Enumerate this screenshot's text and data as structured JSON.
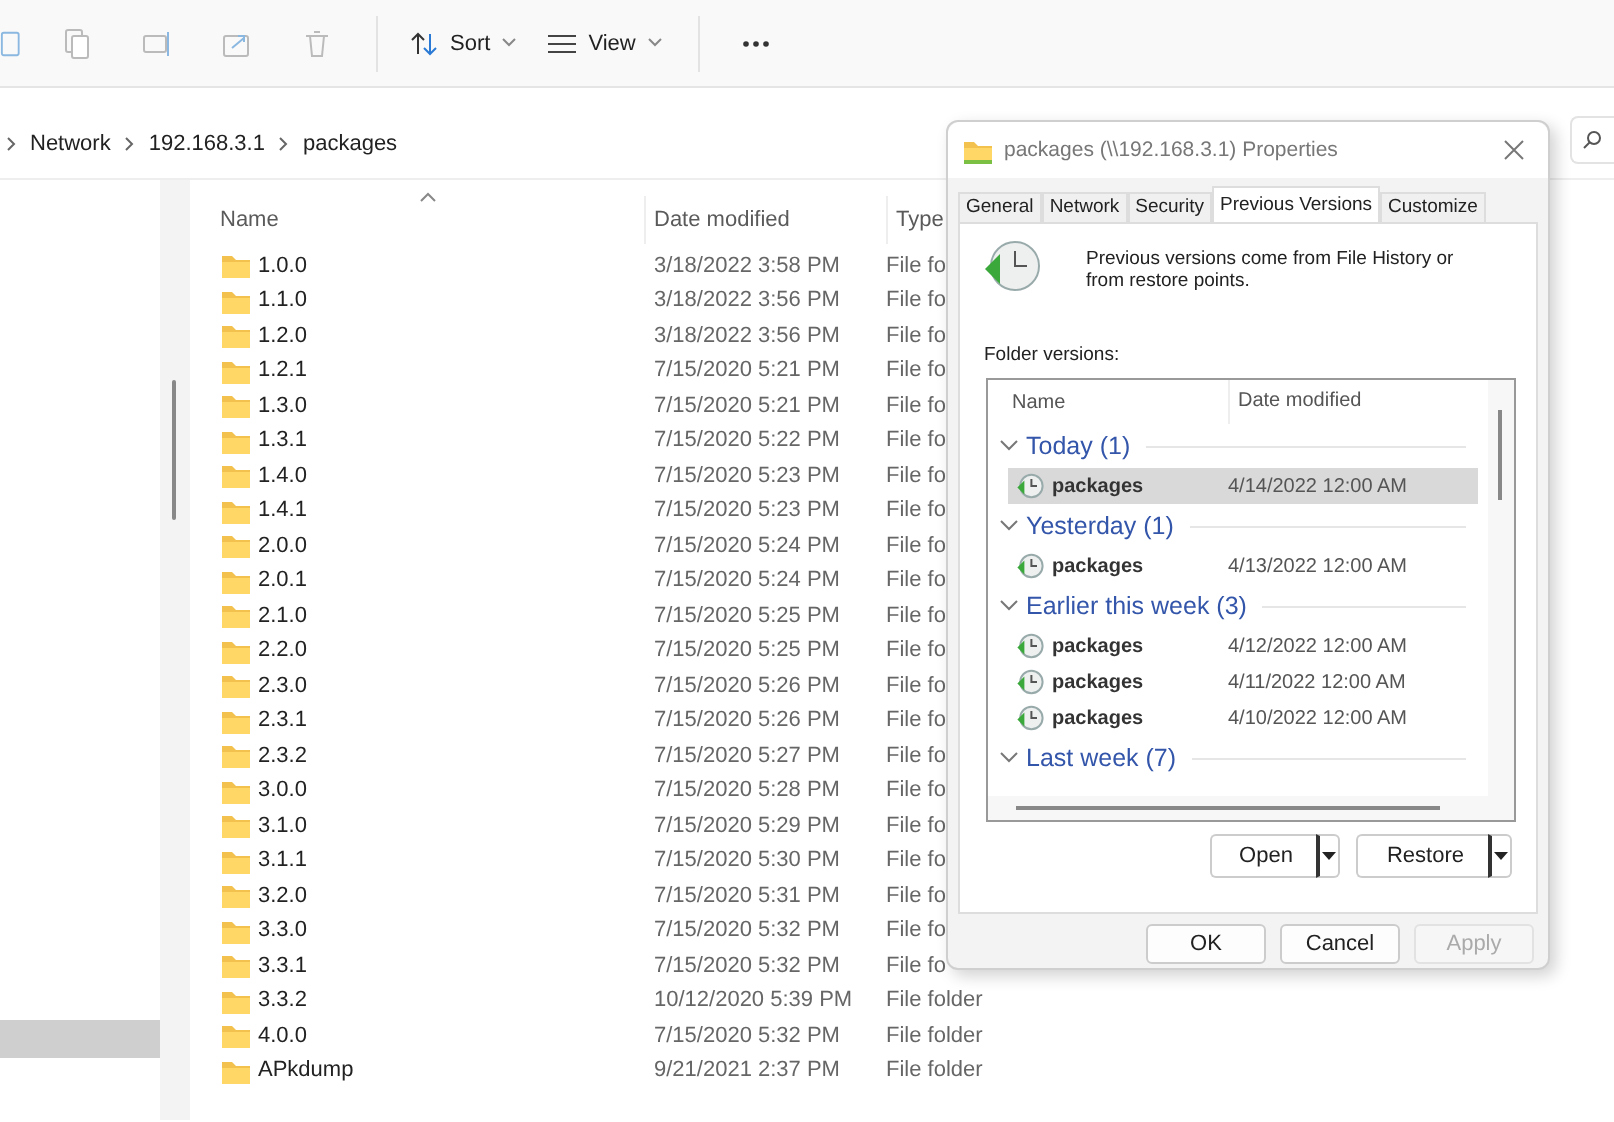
{
  "toolbar": {
    "sort_label": "Sort",
    "view_label": "View"
  },
  "breadcrumb": [
    "Network",
    "192.168.3.1",
    "packages"
  ],
  "file_list": {
    "columns": [
      "Name",
      "Date modified",
      "Type"
    ],
    "rows": [
      {
        "name": "1.0.0",
        "date": "3/18/2022 3:58 PM",
        "type": "File fo"
      },
      {
        "name": "1.1.0",
        "date": "3/18/2022 3:56 PM",
        "type": "File fo"
      },
      {
        "name": "1.2.0",
        "date": "3/18/2022 3:56 PM",
        "type": "File fo"
      },
      {
        "name": "1.2.1",
        "date": "7/15/2020 5:21 PM",
        "type": "File fo"
      },
      {
        "name": "1.3.0",
        "date": "7/15/2020 5:21 PM",
        "type": "File fo"
      },
      {
        "name": "1.3.1",
        "date": "7/15/2020 5:22 PM",
        "type": "File fo"
      },
      {
        "name": "1.4.0",
        "date": "7/15/2020 5:23 PM",
        "type": "File fo"
      },
      {
        "name": "1.4.1",
        "date": "7/15/2020 5:23 PM",
        "type": "File fo"
      },
      {
        "name": "2.0.0",
        "date": "7/15/2020 5:24 PM",
        "type": "File fo"
      },
      {
        "name": "2.0.1",
        "date": "7/15/2020 5:24 PM",
        "type": "File fo"
      },
      {
        "name": "2.1.0",
        "date": "7/15/2020 5:25 PM",
        "type": "File fo"
      },
      {
        "name": "2.2.0",
        "date": "7/15/2020 5:25 PM",
        "type": "File fo"
      },
      {
        "name": "2.3.0",
        "date": "7/15/2020 5:26 PM",
        "type": "File fo"
      },
      {
        "name": "2.3.1",
        "date": "7/15/2020 5:26 PM",
        "type": "File fo"
      },
      {
        "name": "2.3.2",
        "date": "7/15/2020 5:27 PM",
        "type": "File fo"
      },
      {
        "name": "3.0.0",
        "date": "7/15/2020 5:28 PM",
        "type": "File fo"
      },
      {
        "name": "3.1.0",
        "date": "7/15/2020 5:29 PM",
        "type": "File fo"
      },
      {
        "name": "3.1.1",
        "date": "7/15/2020 5:30 PM",
        "type": "File fo"
      },
      {
        "name": "3.2.0",
        "date": "7/15/2020 5:31 PM",
        "type": "File fo"
      },
      {
        "name": "3.3.0",
        "date": "7/15/2020 5:32 PM",
        "type": "File fo"
      },
      {
        "name": "3.3.1",
        "date": "7/15/2020 5:32 PM",
        "type": "File fo"
      },
      {
        "name": "3.3.2",
        "date": "10/12/2020 5:39 PM",
        "type": "File folder"
      },
      {
        "name": "4.0.0",
        "date": "7/15/2020 5:32 PM",
        "type": "File folder"
      },
      {
        "name": "APkdump",
        "date": "9/21/2021 2:37 PM",
        "type": "File folder"
      }
    ]
  },
  "dialog": {
    "title": "packages (\\\\192.168.3.1) Properties",
    "tabs": [
      {
        "label": "General",
        "selected": false
      },
      {
        "label": "Network",
        "selected": false
      },
      {
        "label": "Security",
        "selected": false
      },
      {
        "label": "Previous Versions",
        "selected": true
      },
      {
        "label": "Customize",
        "selected": false
      }
    ],
    "description": "Previous versions come from File History or from restore points.",
    "versions_label": "Folder versions:",
    "versions_columns": [
      "Name",
      "Date modified"
    ],
    "groups": [
      {
        "label": "Today (1)",
        "expanded": true,
        "items": [
          {
            "name": "packages",
            "date": "4/14/2022 12:00 AM",
            "selected": true
          }
        ]
      },
      {
        "label": "Yesterday (1)",
        "expanded": true,
        "items": [
          {
            "name": "packages",
            "date": "4/13/2022 12:00 AM",
            "selected": false
          }
        ]
      },
      {
        "label": "Earlier this week (3)",
        "expanded": true,
        "items": [
          {
            "name": "packages",
            "date": "4/12/2022 12:00 AM",
            "selected": false
          },
          {
            "name": "packages",
            "date": "4/11/2022 12:00 AM",
            "selected": false
          },
          {
            "name": "packages",
            "date": "4/10/2022 12:00 AM",
            "selected": false
          }
        ]
      },
      {
        "label": "Last week (7)",
        "expanded": true
      }
    ],
    "split_buttons": [
      "Open",
      "Restore"
    ],
    "buttons": [
      {
        "label": "OK",
        "disabled": false
      },
      {
        "label": "Cancel",
        "disabled": false
      },
      {
        "label": "Apply",
        "disabled": true
      }
    ]
  }
}
